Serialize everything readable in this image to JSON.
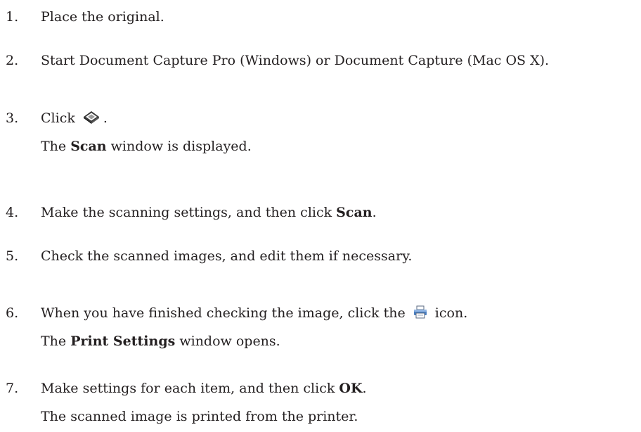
{
  "steps": [
    {
      "number": "1.",
      "text": "Place the original."
    },
    {
      "number": "2.",
      "text": "Start Document Capture Pro (Windows) or Document Capture (Mac OS X)."
    },
    {
      "number": "3.",
      "text_before": "Click",
      "icon": "scanner-icon",
      "text_after": ".",
      "note_prefix": "The",
      "note_bold": "Scan",
      "note_suffix": "window is displayed."
    },
    {
      "number": "4.",
      "text_before": "Make the scanning settings, and then click",
      "bold": "Scan",
      "text_after": "."
    },
    {
      "number": "5.",
      "text": "Check the scanned images, and edit them if necessary."
    },
    {
      "number": "6.",
      "text_before": "When you have finished checking the image, click the",
      "icon": "printer-icon",
      "text_after": "icon.",
      "note_prefix": "The",
      "note_bold": "Print Settings",
      "note_suffix": "window opens."
    },
    {
      "number": "7.",
      "text_before": "Make settings for each item, and then click",
      "bold": "OK",
      "text_after": ".",
      "note": "The scanned image is printed from the printer."
    }
  ]
}
